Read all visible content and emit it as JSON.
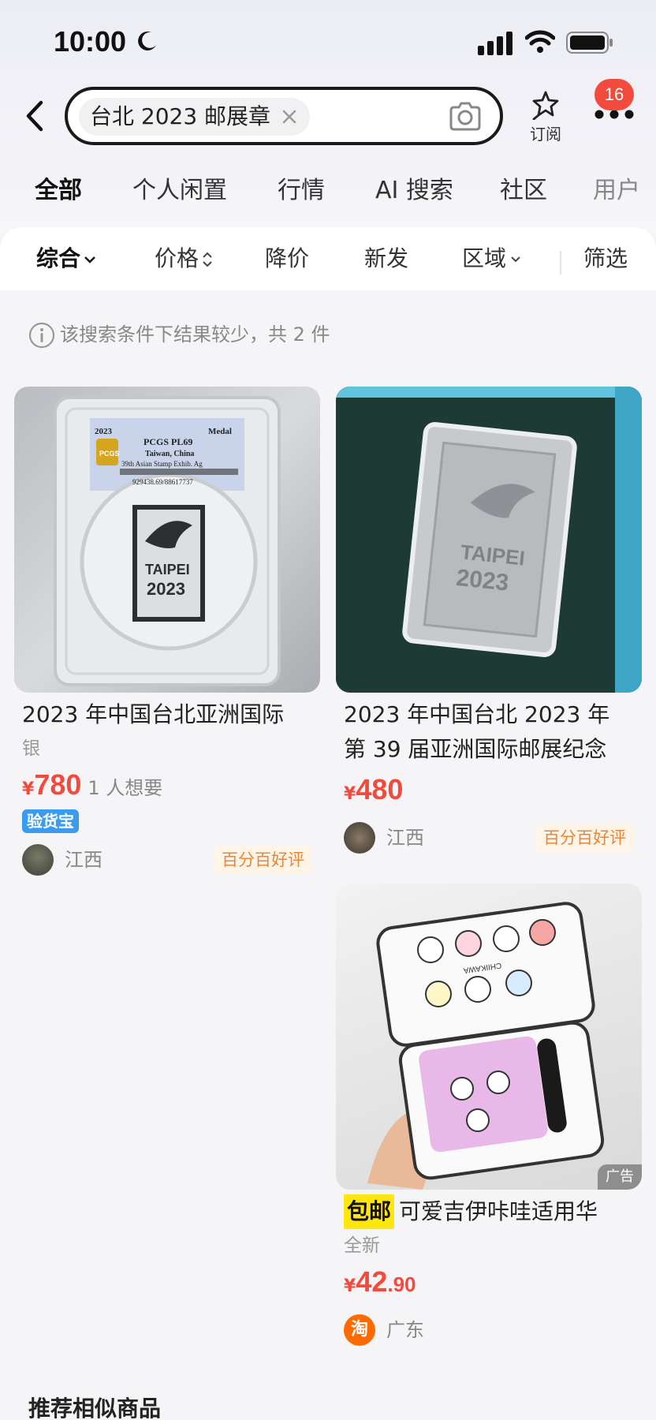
{
  "status_bar": {
    "time": "10:00"
  },
  "search": {
    "query": "台北 2023 邮展章"
  },
  "header": {
    "subscribe_label": "订阅",
    "badge_count": "16"
  },
  "tabs": [
    {
      "label": "全部"
    },
    {
      "label": "个人闲置"
    },
    {
      "label": "行情"
    },
    {
      "label": "AI 搜索"
    },
    {
      "label": "社区"
    },
    {
      "label": "用户"
    }
  ],
  "sort_bar": {
    "items": [
      {
        "label": "综合"
      },
      {
        "label": "价格"
      },
      {
        "label": "降价"
      },
      {
        "label": "新发"
      },
      {
        "label": "区域"
      },
      {
        "label": "筛选"
      }
    ]
  },
  "notice": {
    "text": "该搜索条件下结果较少，共 2 件"
  },
  "products": [
    {
      "title": "2023 年中国台北亚洲国际",
      "subtitle": "银",
      "currency": "¥",
      "price": "780",
      "wants": "1 人想要",
      "verify_tag": "验货宝",
      "region": "江西",
      "rating_tag": "百分百好评",
      "slab_label": {
        "year": "2023",
        "kind": "Medal",
        "grade": "PCGS PL69",
        "country": "Taiwan, China",
        "desc": "39th Asian Stamp Exhib. Ag",
        "serial": "929438.69/88617737",
        "brand": "PCGS"
      },
      "medal_text": {
        "city": "TAIPEI",
        "year": "2023"
      }
    },
    {
      "title": "2023 年中国台北 2023 年",
      "title_line2": "第 39 届亚洲国际邮展纪念",
      "currency": "¥",
      "price": "480",
      "region": "江西",
      "rating_tag": "百分百好评",
      "medal_text": {
        "city": "TAIPEI",
        "year": "2023"
      }
    },
    {
      "free_shipping_tag": "包邮",
      "title": "可爱吉伊咔哇适用华",
      "subtitle": "全新",
      "currency": "¥",
      "price_int": "42",
      "price_dec": ".90",
      "region": "广东",
      "shop_logo": "淘",
      "ad_tag": "广告",
      "case_text": "CHIIKAWA"
    }
  ],
  "similar_section": {
    "title": "推荐相似商品"
  },
  "colors": {
    "accent_yellow": "#ffe60f",
    "price_red": "#f24a3c",
    "rating_orange": "#e8863a",
    "verify_blue": "#3a9cf0"
  }
}
